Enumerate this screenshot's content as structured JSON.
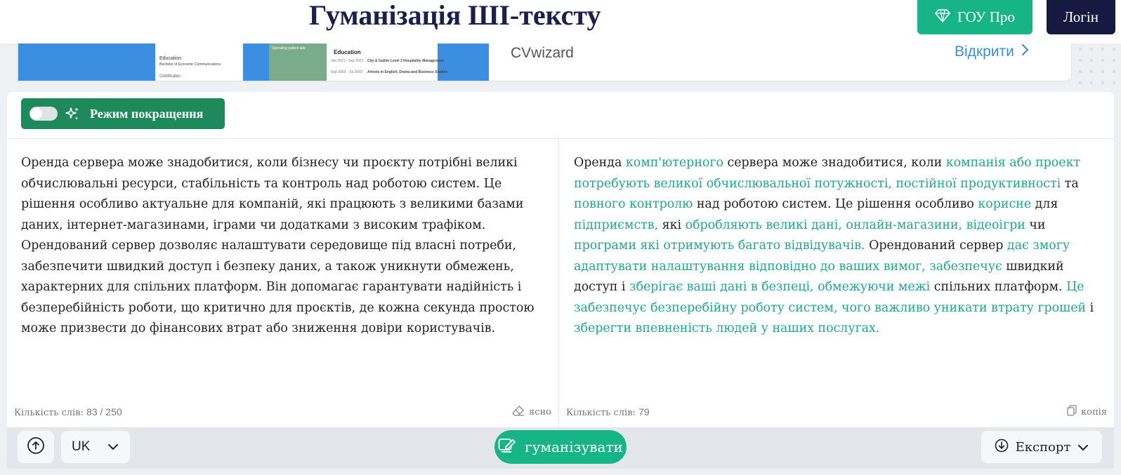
{
  "header": {
    "title": "Гуманізація ШІ-тексту",
    "pro_label": "ГОУ Про",
    "login_label": "Логін"
  },
  "ad": {
    "brand": "CVwizard",
    "open_label": "Відкрити",
    "doc1_lines": [
      "Education",
      "Bachelor of Economic Communications",
      "Certificates"
    ],
    "doc2_side": "Operating patient ads",
    "doc2_heading": "Education",
    "doc2_lines": [
      "Jan 2021 - Sep 2021",
      "City & Guilds Level 3 Hospitality Management",
      "Sep 2003 - Jul 2003",
      "Artexts in English, Drama and Business Studies"
    ]
  },
  "toolbar": {
    "mode_label": "Режим покращення"
  },
  "input": {
    "text": "Оренда сервера може знадобитися, коли бізнесу чи проєкту потрібні великі обчислювальні ресурси, стабільність та контроль над роботою систем. Це рішення особливо актуальне для компаній, які працюють з великими базами даних, інтернет-магазинами, іграми чи додатками з високим трафіком. Орендований сервер дозволяє налаштувати середовище під власні потреби, забезпечити швидкий доступ і безпеку даних, а також уникнути обмежень, характерних для спільних платформ. Він допомагає гарантувати надійність і безперебійність роботи, що критично для проєктів, де кожна секунда простою може призвести до фінансових втрат або зниження довіри користувачів.",
    "count_label": "Кількість слів:",
    "count_value": "83 / 250",
    "clear_label": "ясно"
  },
  "output": {
    "segments": [
      {
        "t": "Оренда ",
        "h": false
      },
      {
        "t": "комп'ютерного",
        "h": true
      },
      {
        "t": " сервера може знадобитися, коли ",
        "h": false
      },
      {
        "t": "компанія або проект потребують великої обчислювальної потужності, постійної продуктивності",
        "h": true
      },
      {
        "t": " та ",
        "h": false
      },
      {
        "t": "повного контролю",
        "h": true
      },
      {
        "t": " над роботою систем. Це рішення особливо ",
        "h": false
      },
      {
        "t": "корисне",
        "h": true
      },
      {
        "t": " для ",
        "h": false
      },
      {
        "t": "підприємств,",
        "h": true
      },
      {
        "t": " які ",
        "h": false
      },
      {
        "t": "обробляють великі дані, онлайн-магазини, відеоігри",
        "h": true
      },
      {
        "t": " чи ",
        "h": false
      },
      {
        "t": "програми які отримують багато відвідувачів.",
        "h": true
      },
      {
        "t": " Орендований сервер ",
        "h": false
      },
      {
        "t": "дає змогу адаптувати налаштування відповідно до ваших вимог, забезпечує",
        "h": true
      },
      {
        "t": " швидкий доступ і ",
        "h": false
      },
      {
        "t": "зберігає ваші дані в безпеці, обмежуючи межі",
        "h": true
      },
      {
        "t": " спільних платформ. ",
        "h": false
      },
      {
        "t": "Це забезпечує безперебійну роботу систем, чого важливо уникати втрату грошей",
        "h": true
      },
      {
        "t": " і ",
        "h": false
      },
      {
        "t": "зберегти впевненість людей у наших послугах.",
        "h": true
      }
    ],
    "count_label": "Кількість слів:",
    "count_value": "79",
    "copy_label": "копія"
  },
  "bottom": {
    "lang_label": "UK",
    "humanize_label": "гуманізувати",
    "export_label": "Експорт"
  },
  "colors": {
    "accent": "#17b586",
    "mode_button": "#1e8a5c",
    "dark_button": "#161a40",
    "highlight": "#1fa78a",
    "title": "#1a1f4b"
  },
  "icons": [
    "diamond-icon",
    "sparkle-icon",
    "chevron-right-icon",
    "eraser-icon",
    "copy-icon",
    "upload-icon",
    "chevron-down-icon",
    "pen-icon",
    "download-icon"
  ]
}
